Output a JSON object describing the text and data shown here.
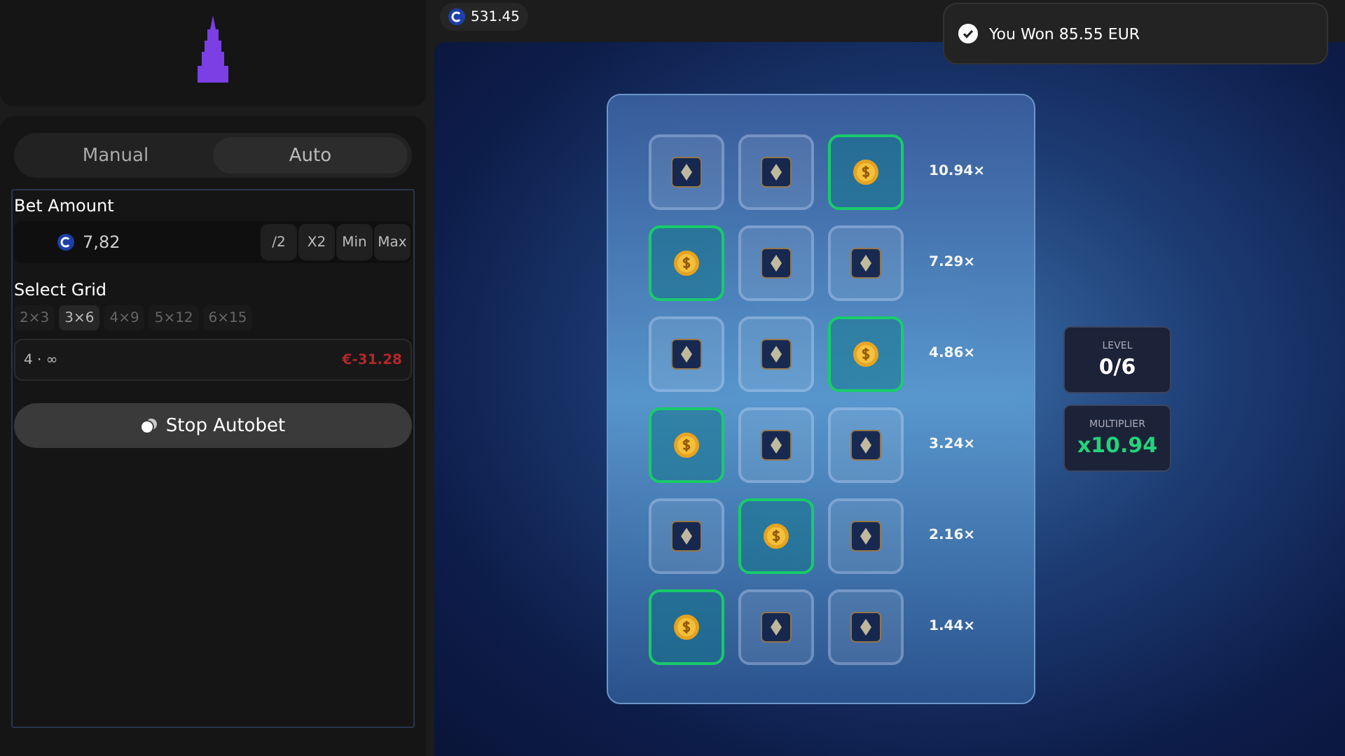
{
  "balance": "531.45",
  "toast": {
    "message": "You Won 85.55 EUR"
  },
  "mode_tabs": [
    {
      "label": "Manual",
      "selected": false
    },
    {
      "label": "Auto",
      "selected": true
    }
  ],
  "bet_amount": {
    "label": "Bet Amount",
    "value": "7,82",
    "buttons": [
      "/2",
      "X2",
      "Min",
      "Max"
    ]
  },
  "select_grid": {
    "label": "Select Grid",
    "options": [
      {
        "label": "2×3",
        "selected": false
      },
      {
        "label": "3×6",
        "selected": true
      },
      {
        "label": "4×9",
        "selected": false
      },
      {
        "label": "5×12",
        "selected": false
      },
      {
        "label": "6×15",
        "selected": false
      }
    ]
  },
  "autobet_info": {
    "count": "4 · ∞",
    "profit": "€-31.28"
  },
  "stop_button": "Stop Autobet",
  "board": {
    "rows": [
      {
        "multiplier": "10.94×",
        "cells": [
          {
            "kind": "gem"
          },
          {
            "kind": "gem"
          },
          {
            "kind": "coin"
          }
        ]
      },
      {
        "multiplier": "7.29×",
        "cells": [
          {
            "kind": "coin"
          },
          {
            "kind": "gem"
          },
          {
            "kind": "gem"
          }
        ]
      },
      {
        "multiplier": "4.86×",
        "cells": [
          {
            "kind": "gem"
          },
          {
            "kind": "gem"
          },
          {
            "kind": "coin"
          }
        ]
      },
      {
        "multiplier": "3.24×",
        "cells": [
          {
            "kind": "coin"
          },
          {
            "kind": "gem"
          },
          {
            "kind": "gem"
          }
        ]
      },
      {
        "multiplier": "2.16×",
        "cells": [
          {
            "kind": "gem"
          },
          {
            "kind": "coin"
          },
          {
            "kind": "gem"
          }
        ]
      },
      {
        "multiplier": "1.44×",
        "cells": [
          {
            "kind": "coin"
          },
          {
            "kind": "gem"
          },
          {
            "kind": "gem"
          }
        ]
      }
    ]
  },
  "level": {
    "label": "LEVEL",
    "value": "0/6"
  },
  "multiplier": {
    "label": "MULTIPLIER",
    "value": "x10.94"
  }
}
